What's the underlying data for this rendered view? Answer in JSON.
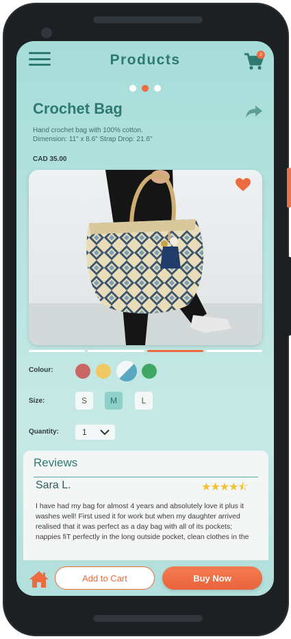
{
  "header": {
    "title": "Products",
    "cart_count": "2",
    "menu_icon": "hamburger-menu-icon",
    "cart_icon": "shopping-cart-icon"
  },
  "carousel": {
    "dots": 3,
    "active_index": 1
  },
  "product": {
    "name": "Crochet Bag",
    "description_line1": "Hand crochet bag with 100% cotton.",
    "description_line2": "Dimension: 11\" x 8.6\" Strap Drop: 21.6\"",
    "price": "CAD 35.00",
    "share_icon": "share-icon",
    "favorite_icon": "heart-icon",
    "favorited": true
  },
  "image_tabs": {
    "count": 4,
    "active_index": 2
  },
  "options": {
    "colour_label": "Colour:",
    "colours": [
      "#c86763",
      "#f0c962",
      "#5aa7c2",
      "#3ea764"
    ],
    "selected_colour_index": 2,
    "size_label": "Size:",
    "sizes": [
      "S",
      "M",
      "L"
    ],
    "selected_size": "M",
    "quantity_label": "Quantity:",
    "quantity": "1"
  },
  "reviews": {
    "title": "Reviews",
    "items": [
      {
        "name": "Sara L.",
        "rating": 4.5,
        "stars": "★★★★⯪",
        "text": "I have had my bag for almost 4 years and absolutely love it plus it washes well! First used it for work but when my daughter arrived realised that it was perfect as a day bag with all of its pockets; nappies fiT perfectly in the long outside pocket, clean clothes in the bottom pocket..."
      }
    ]
  },
  "bottom_bar": {
    "home_icon": "home-icon",
    "add_to_cart": "Add to Cart",
    "buy_now": "Buy Now"
  },
  "colors": {
    "accent": "#ee6a3f",
    "teal": "#2e7a73",
    "background": "#a6dcd8"
  }
}
